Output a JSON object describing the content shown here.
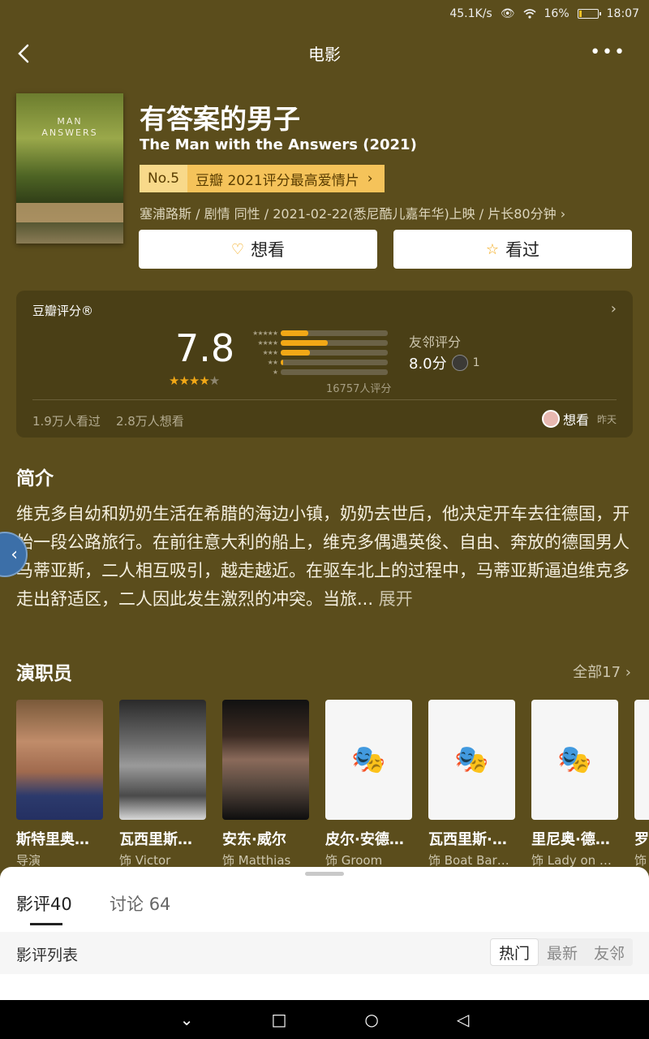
{
  "status": {
    "speed": "45.1K/s",
    "battery_pct": "16%",
    "battery_level": 0.16,
    "time": "18:07"
  },
  "topbar": {
    "title": "电影"
  },
  "poster": {
    "line1": "MAN",
    "line2": "ANSWERS"
  },
  "movie": {
    "title": "有答案的男子",
    "title_en": "The Man with the Answers (2021)",
    "rank_no": "No.5",
    "rank_text": "豆瓣 2021评分最高爱情片",
    "meta": "塞浦路斯 / 剧情 同性 / 2021-02-22(悉尼酷儿嘉年华)上映 / 片长80分钟"
  },
  "actions": {
    "want": "想看",
    "seen": "看过"
  },
  "rating": {
    "label": "豆瓣评分®",
    "score": "7.8",
    "stars": 4,
    "star_labels": [
      "★★★★★",
      "★★★★",
      "★★★",
      "★★",
      "★"
    ],
    "distribution": [
      0.26,
      0.44,
      0.27,
      0.02,
      0.0
    ],
    "count": "16757人评分",
    "friend_label": "友邻评分",
    "friend_score": "8.0分",
    "friend_count": "1",
    "watched": "1.9万人看过",
    "wanted": "2.8万人想看",
    "recent_action": "想看",
    "recent_time": "昨天"
  },
  "intro": {
    "title": "简介",
    "text": "维克多自幼和奶奶生活在希腊的海边小镇，奶奶去世后，他决定开车去往德国，开始一段公路旅行。在前往意大利的船上，维克多偶遇英俊、自由、奔放的德国男人马蒂亚斯，二人相互吸引，越走越近。在驱车北上的过程中，马蒂亚斯逼迫维克多走出舒适区，二人因此发生激烈的冲突。当旅...",
    "expand": "展开"
  },
  "cast": {
    "title": "演职员",
    "all": "全部17",
    "members": [
      {
        "name": "斯特里奥…",
        "role": "导演"
      },
      {
        "name": "瓦西里斯…",
        "role": "饰 Victor"
      },
      {
        "name": "安东·威尔",
        "role": "饰 Matthias"
      },
      {
        "name": "皮尔·安德…",
        "role": "饰 Groom"
      },
      {
        "name": "瓦西里斯·…",
        "role": "饰 Boat Bar…"
      },
      {
        "name": "里尼奥·德…",
        "role": "饰 Lady on …"
      },
      {
        "name": "罗",
        "role": "饰"
      }
    ]
  },
  "sheet": {
    "tab1": "影评",
    "tab1_count": "40",
    "tab2": "讨论",
    "tab2_count": "64",
    "list_label": "影评列表",
    "filters": [
      "热门",
      "最新",
      "友邻"
    ]
  }
}
